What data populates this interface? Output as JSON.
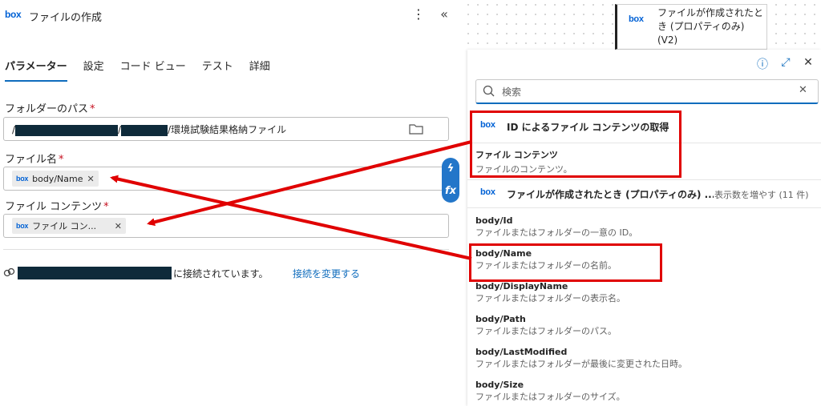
{
  "left": {
    "logo": "box",
    "title": "ファイルの作成",
    "more_icon": "⋮",
    "collapse_icon": "«",
    "tabs": [
      "パラメーター",
      "設定",
      "コード ビュー",
      "テスト",
      "詳細"
    ],
    "folder": {
      "label": "フォルダーのパス",
      "required": "*",
      "prefix": "/",
      "sep": "/",
      "suffix": "/環境試験結果格納ファイル"
    },
    "filename": {
      "label": "ファイル名",
      "required": "*",
      "chip": "body/Name"
    },
    "content": {
      "label": "ファイル コンテンツ",
      "required": "*",
      "chip": "ファイル コン..."
    },
    "connection_text": "に接続されています。",
    "change_link": "接続を変更する"
  },
  "canvas": {
    "node_title": "ファイルが作成されたとき (プロパティのみ) (V2)"
  },
  "panel": {
    "search_placeholder": "検索",
    "section1": {
      "title": "ID によるファイル コンテンツの取得",
      "items": [
        {
          "title": "ファイル コンテンツ",
          "desc": "ファイルのコンテンツ。"
        }
      ]
    },
    "section2": {
      "title": "ファイルが作成されたとき (プロパティのみ) ...",
      "more": "表示数を増やす (11 件)",
      "items": [
        {
          "title": "body/Id",
          "desc": "ファイルまたはフォルダーの一意の ID。"
        },
        {
          "title": "body/Name",
          "desc": "ファイルまたはフォルダーの名前。"
        },
        {
          "title": "body/DisplayName",
          "desc": "ファイルまたはフォルダーの表示名。"
        },
        {
          "title": "body/Path",
          "desc": "ファイルまたはフォルダーのパス。"
        },
        {
          "title": "body/LastModified",
          "desc": "ファイルまたはフォルダーが最後に変更された日時。"
        },
        {
          "title": "body/Size",
          "desc": "ファイルまたはフォルダーのサイズ。"
        }
      ]
    }
  },
  "colors": {
    "accent": "#0f6cbd",
    "annotation": "#e00000",
    "redaction": "#0e2a3a"
  }
}
